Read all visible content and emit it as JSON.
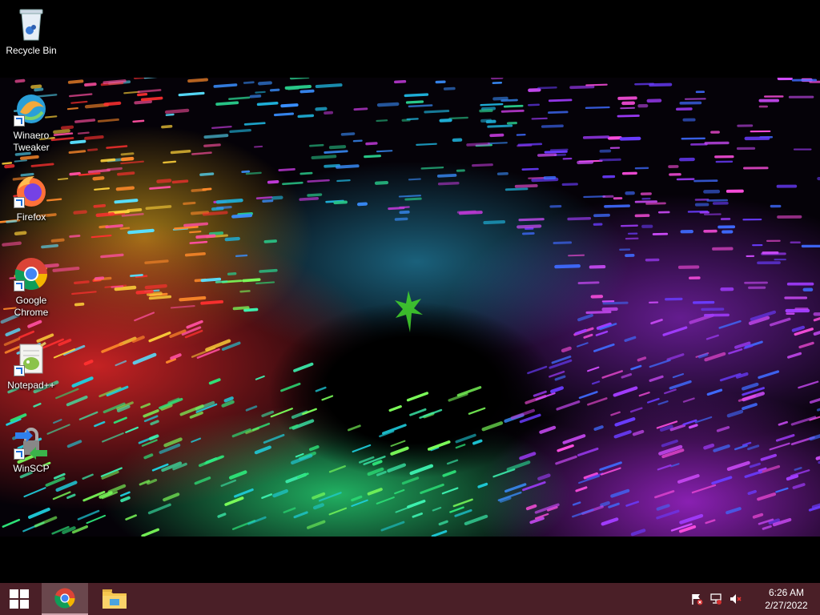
{
  "desktop": {
    "icons": [
      {
        "label": "Recycle Bin",
        "icon": "recycle-bin-icon"
      },
      {
        "label": "Winaero Tweaker",
        "icon": "winaero-tweaker-icon"
      },
      {
        "label": "Firefox",
        "icon": "firefox-icon"
      },
      {
        "label": "Google Chrome",
        "icon": "chrome-icon"
      },
      {
        "label": "Notepad++",
        "icon": "notepad-plus-plus-icon"
      },
      {
        "label": "WinSCP",
        "icon": "winscp-icon"
      }
    ]
  },
  "taskbar": {
    "start": {
      "icon": "windows-logo-icon"
    },
    "pinned": [
      {
        "app": "chrome",
        "icon": "chrome-icon",
        "active": true
      },
      {
        "app": "explorer",
        "icon": "file-explorer-icon",
        "active": false
      }
    ],
    "tray": {
      "icons": [
        "action-center-flag-icon",
        "network-icon",
        "volume-muted-icon"
      ],
      "time": "6:26 AM",
      "date": "2/27/2022"
    }
  },
  "colors": {
    "taskbar": "#4a1f27",
    "desktop_bg": "#000000",
    "razer_green": "#44d62c"
  }
}
